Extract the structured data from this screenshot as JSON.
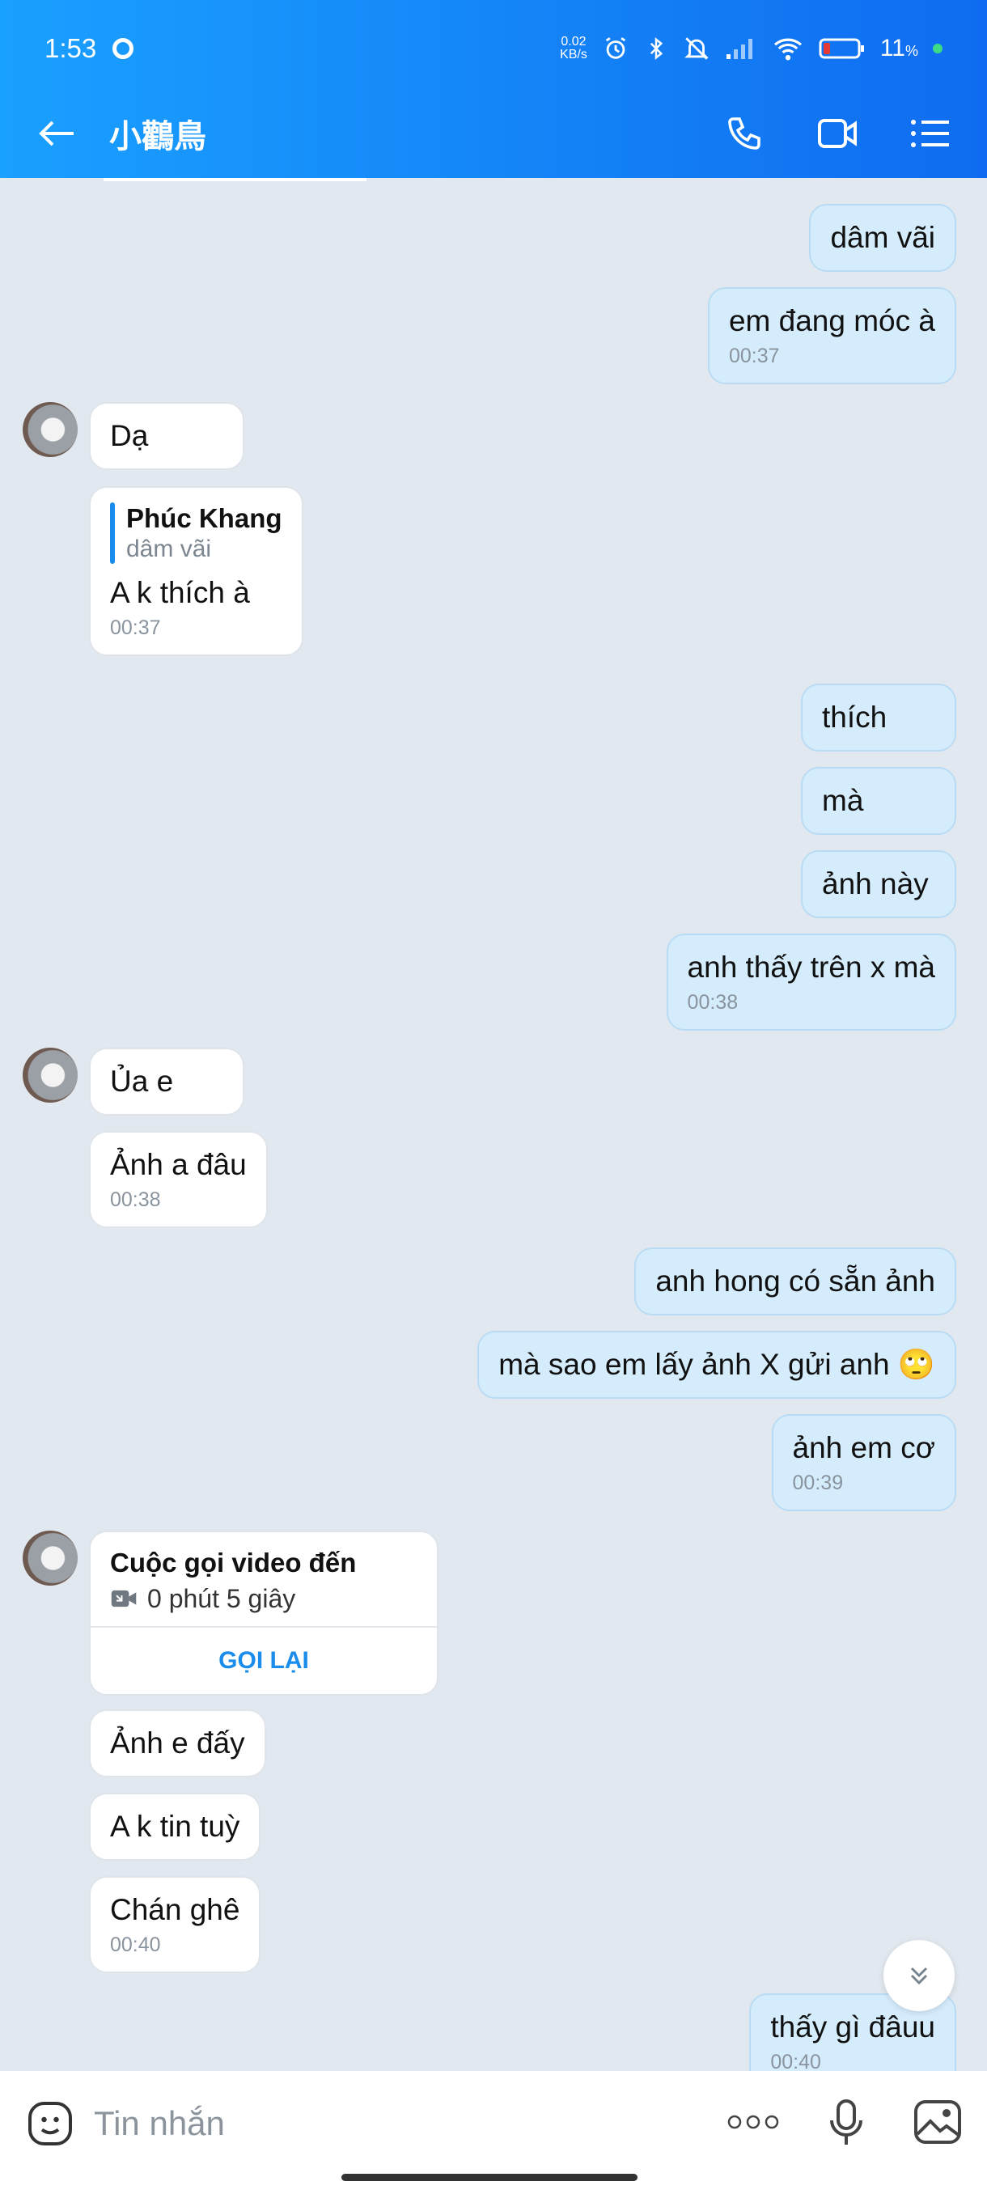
{
  "status": {
    "time": "1:53",
    "net_speed_top": "0.02",
    "net_speed_bottom": "KB/s",
    "battery": "11",
    "battery_unit": "%"
  },
  "header": {
    "title": "小鸛鳥"
  },
  "messages": {
    "m1": {
      "text": "dâm vãi"
    },
    "m2": {
      "text": "em đang móc à",
      "time": "00:37"
    },
    "m3": {
      "text": "Dạ"
    },
    "m4": {
      "quote_name": "Phúc Khang",
      "quote_text": "dâm vãi",
      "text": "A k thích à",
      "time": "00:37"
    },
    "m5": {
      "text": "thích"
    },
    "m6": {
      "text": "mà"
    },
    "m7": {
      "text": "ảnh này"
    },
    "m8": {
      "text": "anh thấy trên x mà",
      "time": "00:38"
    },
    "m9": {
      "text": "Ủa e"
    },
    "m10": {
      "text": "Ảnh a đâu",
      "time": "00:38"
    },
    "m11": {
      "text": "anh hong có sẵn ảnh"
    },
    "m12": {
      "text": "mà sao em lấy ảnh X gửi anh 🙄"
    },
    "m13": {
      "text": "ảnh em cơ",
      "time": "00:39"
    },
    "call": {
      "title": "Cuộc gọi video đến",
      "duration": "0 phút 5 giây",
      "action": "GỌI LẠI"
    },
    "m14": {
      "text": "Ảnh e đấy"
    },
    "m15": {
      "text": "A k tin tuỳ"
    },
    "m16": {
      "text": "Chán ghê",
      "time": "00:40"
    },
    "m17": {
      "text": "thấy gì đâuu",
      "time": "00:40"
    }
  },
  "composer": {
    "placeholder": "Tin nhắn"
  }
}
